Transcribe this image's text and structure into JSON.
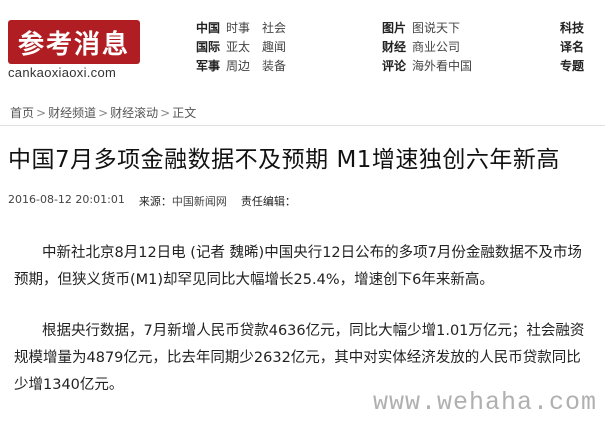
{
  "header": {
    "logo_text": "参考消息",
    "logo_url": "cankaoxiaoxi.com",
    "nav_groups": [
      {
        "rows": [
          {
            "cat": "中国",
            "links": [
              "时事",
              "社会"
            ]
          },
          {
            "cat": "国际",
            "links": [
              "亚太",
              "趣闻"
            ]
          },
          {
            "cat": "军事",
            "links": [
              "周边",
              "装备"
            ]
          }
        ]
      },
      {
        "rows": [
          {
            "cat": "图片",
            "links": [
              "图说天下"
            ]
          },
          {
            "cat": "财经",
            "links": [
              "商业公司"
            ]
          },
          {
            "cat": "评论",
            "links": [
              "海外看中国"
            ]
          }
        ]
      },
      {
        "rows": [
          {
            "cat": "科技",
            "links": []
          },
          {
            "cat": "译名",
            "links": []
          },
          {
            "cat": "专题",
            "links": []
          }
        ]
      }
    ]
  },
  "breadcrumb": [
    "首页",
    "财经频道",
    "财经滚动",
    "正文"
  ],
  "breadcrumb_sep": ">",
  "article": {
    "title": "中国7月多项金融数据不及预期 M1增速独创六年新高",
    "datetime": "2016-08-12 20:01:01",
    "source_label": "来源：",
    "source": "中国新闻网",
    "editor_label": "责任编辑：",
    "paragraphs": [
      "中新社北京8月12日电 (记者 魏晞)中国央行12日公布的多项7月份金融数据不及市场预期，但狭义货币(M1)却罕见同比大幅增长25.4%，增速创下6年来新高。",
      "根据央行数据，7月新增人民币贷款4636亿元，同比大幅少增1.01万亿元；社会融资规模增量为4879亿元，比去年同期少2632亿元，其中对实体经济发放的人民币贷款同比少增1340亿元。"
    ]
  },
  "watermark": "www.wehaha.com",
  "colors": {
    "brand_red": "#b01e23"
  }
}
